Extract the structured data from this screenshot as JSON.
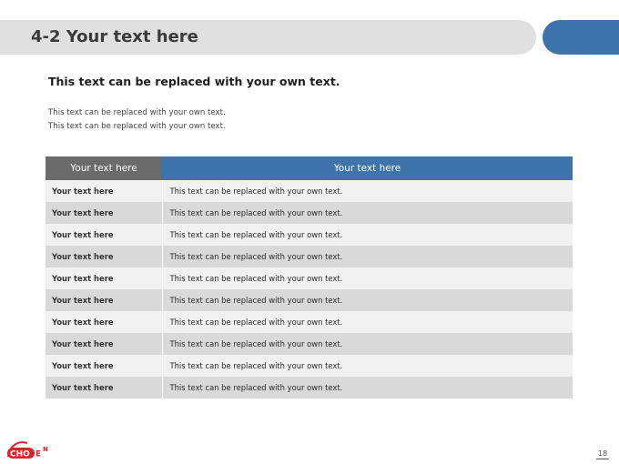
{
  "header": {
    "title": "4-2 Your text here",
    "accent_color": "#3e73ab"
  },
  "content": {
    "subtitle": "This text can be replaced with your own text.",
    "lines": [
      "This text can be replaced with your own text.",
      "This text can be replaced with your own text."
    ]
  },
  "table": {
    "headers": [
      "Your text here",
      "Your text here"
    ],
    "header_colors": [
      "#6b6b6b",
      "#3e73ab"
    ],
    "rows": [
      [
        "Your text here",
        "This text can be replaced with your own text."
      ],
      [
        "Your text here",
        "This text can be replaced with your own text."
      ],
      [
        "Your text here",
        "This text can be replaced with your own text."
      ],
      [
        "Your text here",
        "This text can be replaced with your own text."
      ],
      [
        "Your text here",
        "This text can be replaced with your own text."
      ],
      [
        "Your text here",
        "This text can be replaced with your own text."
      ],
      [
        "Your text here",
        "This text can be replaced with your own text."
      ],
      [
        "Your text here",
        "This text can be replaced with your own text."
      ],
      [
        "Your text here",
        "This text can be replaced with your own text."
      ],
      [
        "Your text here",
        "This text can be replaced with your own text."
      ]
    ]
  },
  "footer": {
    "logo_text": "CHOEN",
    "logo_color": "#d8242b",
    "page_number": "18"
  }
}
